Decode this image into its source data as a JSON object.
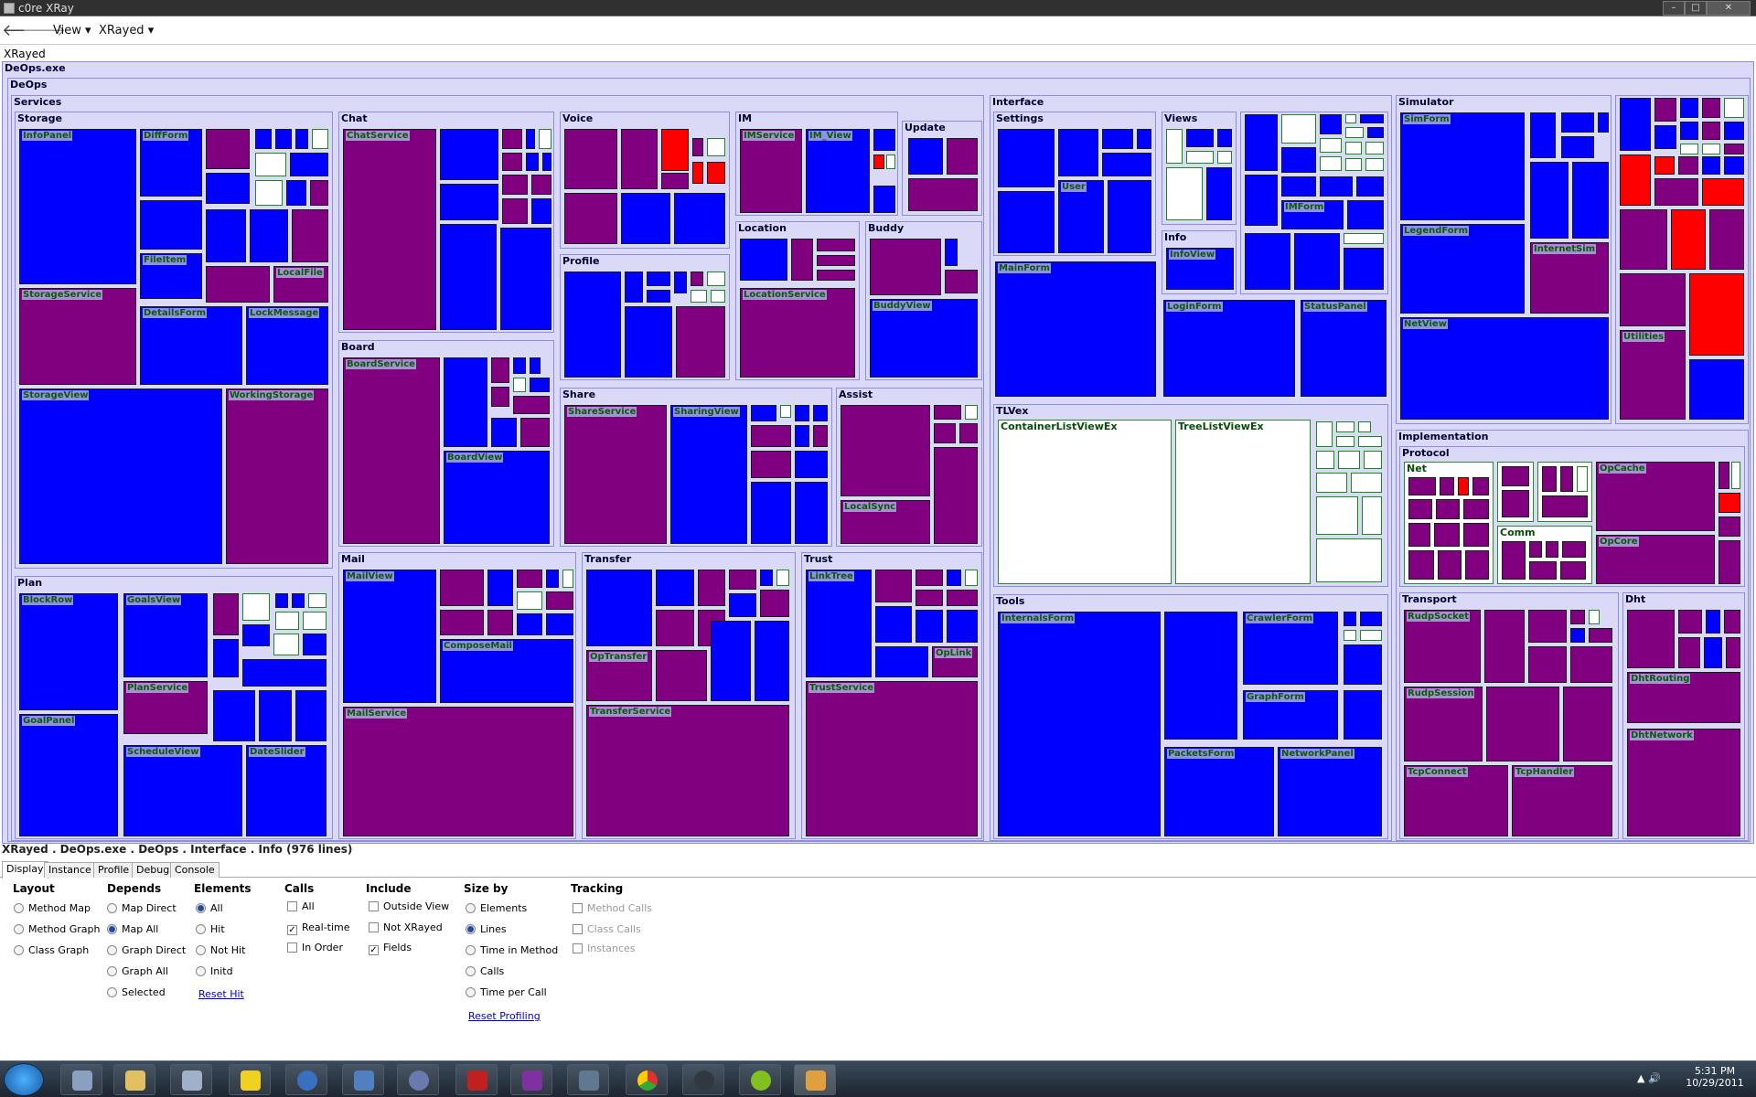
{
  "window": {
    "title": "c0re XRay",
    "min": "–",
    "max": "□",
    "close": "✕"
  },
  "toolbar": {
    "back": "🡐",
    "forward": "🡒",
    "view_menu": "View ▾",
    "xrayed_menu": "XRayed ▾"
  },
  "breadcrumb_root": "XRayed",
  "map": {
    "exe": "DeOps.exe",
    "deops": "DeOps",
    "services": "Services",
    "storage": "Storage",
    "infopanel": "InfoPanel",
    "diffform": "DiffForm",
    "fileitem": "FileItem",
    "localfile": "LocalFile",
    "storageservice": "StorageService",
    "detailsform": "DetailsForm",
    "lockmessage": "LockMessage",
    "storageview": "StorageView",
    "workingstorage": "WorkingStorage",
    "chat": "Chat",
    "chatservice": "ChatService",
    "voice": "Voice",
    "im": "IM",
    "imservice": "IMService",
    "im_view": "IM_View",
    "update": "Update",
    "location": "Location",
    "locationservice": "LocationService",
    "buddy": "Buddy",
    "buddyview": "BuddyView",
    "profile": "Profile",
    "board": "Board",
    "boardservice": "BoardService",
    "boardview": "BoardView",
    "share": "Share",
    "shareservice": "ShareService",
    "sharingview": "SharingView",
    "assist": "Assist",
    "localsync": "LocalSync",
    "plan": "Plan",
    "blockrow": "BlockRow",
    "goalsview": "GoalsView",
    "planservice": "PlanService",
    "goalpanel": "GoalPanel",
    "scheduleview": "ScheduleView",
    "dateslider": "DateSlider",
    "mail": "Mail",
    "mailview": "MailView",
    "composemail": "ComposeMail",
    "mailservice": "MailService",
    "transfer": "Transfer",
    "optransfer": "OpTransfer",
    "transferservice": "TransferService",
    "trust": "Trust",
    "linktree": "LinkTree",
    "oplink": "OpLink",
    "trustservice": "TrustService",
    "interface": "Interface",
    "settings": "Settings",
    "user": "User",
    "views": "Views",
    "imform": "IMForm",
    "info": "Info",
    "infoview": "InfoView",
    "mainform": "MainForm",
    "loginform": "LoginForm",
    "statuspanel": "StatusPanel",
    "tlvex": "TLVex",
    "containerlistviewex": "ContainerListViewEx",
    "treelistviewex": "TreeListViewEx",
    "tools": "Tools",
    "internalsform": "InternalsForm",
    "crawlerform": "CrawlerForm",
    "graphform": "GraphForm",
    "packetsform": "PacketsForm",
    "networkpanel": "NetworkPanel",
    "simulator": "Simulator",
    "simform": "SimForm",
    "legendform": "LegendForm",
    "internetsim": "InternetSim",
    "netview": "NetView",
    "utilities": "Utilities",
    "implementation": "Implementation",
    "protocol": "Protocol",
    "net": "Net",
    "comm": "Comm",
    "opcache": "OpCache",
    "opcore": "OpCore",
    "transport": "Transport",
    "rudpsocket": "RudpSocket",
    "rudpsession": "RudpSession",
    "tcpconnect": "TcpConnect",
    "tcphandler": "TcpHandler",
    "dht": "Dht",
    "dhtrouting": "DhtRouting",
    "dhtnetwork": "DhtNetwork"
  },
  "status_line": "XRayed . DeOps.exe . DeOps . Interface . Info  (976 lines)",
  "tabs": [
    "Display",
    "Instance",
    "Profile",
    "Debug",
    "Console"
  ],
  "panel": {
    "layout": {
      "title": "Layout",
      "options": [
        "Method Map",
        "Method Graph",
        "Class Graph"
      ]
    },
    "depends": {
      "title": "Depends",
      "options": [
        "Map Direct",
        "Map All",
        "Graph Direct",
        "Graph All",
        "Selected"
      ]
    },
    "elements": {
      "title": "Elements",
      "options": [
        "All",
        "Hit",
        "Not Hit",
        "Initd"
      ],
      "reset": "Reset Hit"
    },
    "calls": {
      "title": "Calls",
      "options": [
        "All",
        "Real-time",
        "In Order"
      ]
    },
    "include": {
      "title": "Include",
      "options": [
        "Outside View",
        "Not XRayed",
        "Fields"
      ]
    },
    "sizeby": {
      "title": "Size by",
      "options": [
        "Elements",
        "Lines",
        "Time in Method",
        "Calls",
        "Time per Call"
      ],
      "reset": "Reset Profiling"
    },
    "tracking": {
      "title": "Tracking",
      "options": [
        "Method Calls",
        "Class Calls",
        "Instances"
      ]
    }
  },
  "taskbar": {
    "time": "5:31 PM",
    "date": "10/29/2011",
    "tray": "▲ 🔊"
  },
  "colors": {
    "blue": "#0000ff",
    "purple": "#800080",
    "red": "#ff0000",
    "frame": "#dadaf8"
  }
}
